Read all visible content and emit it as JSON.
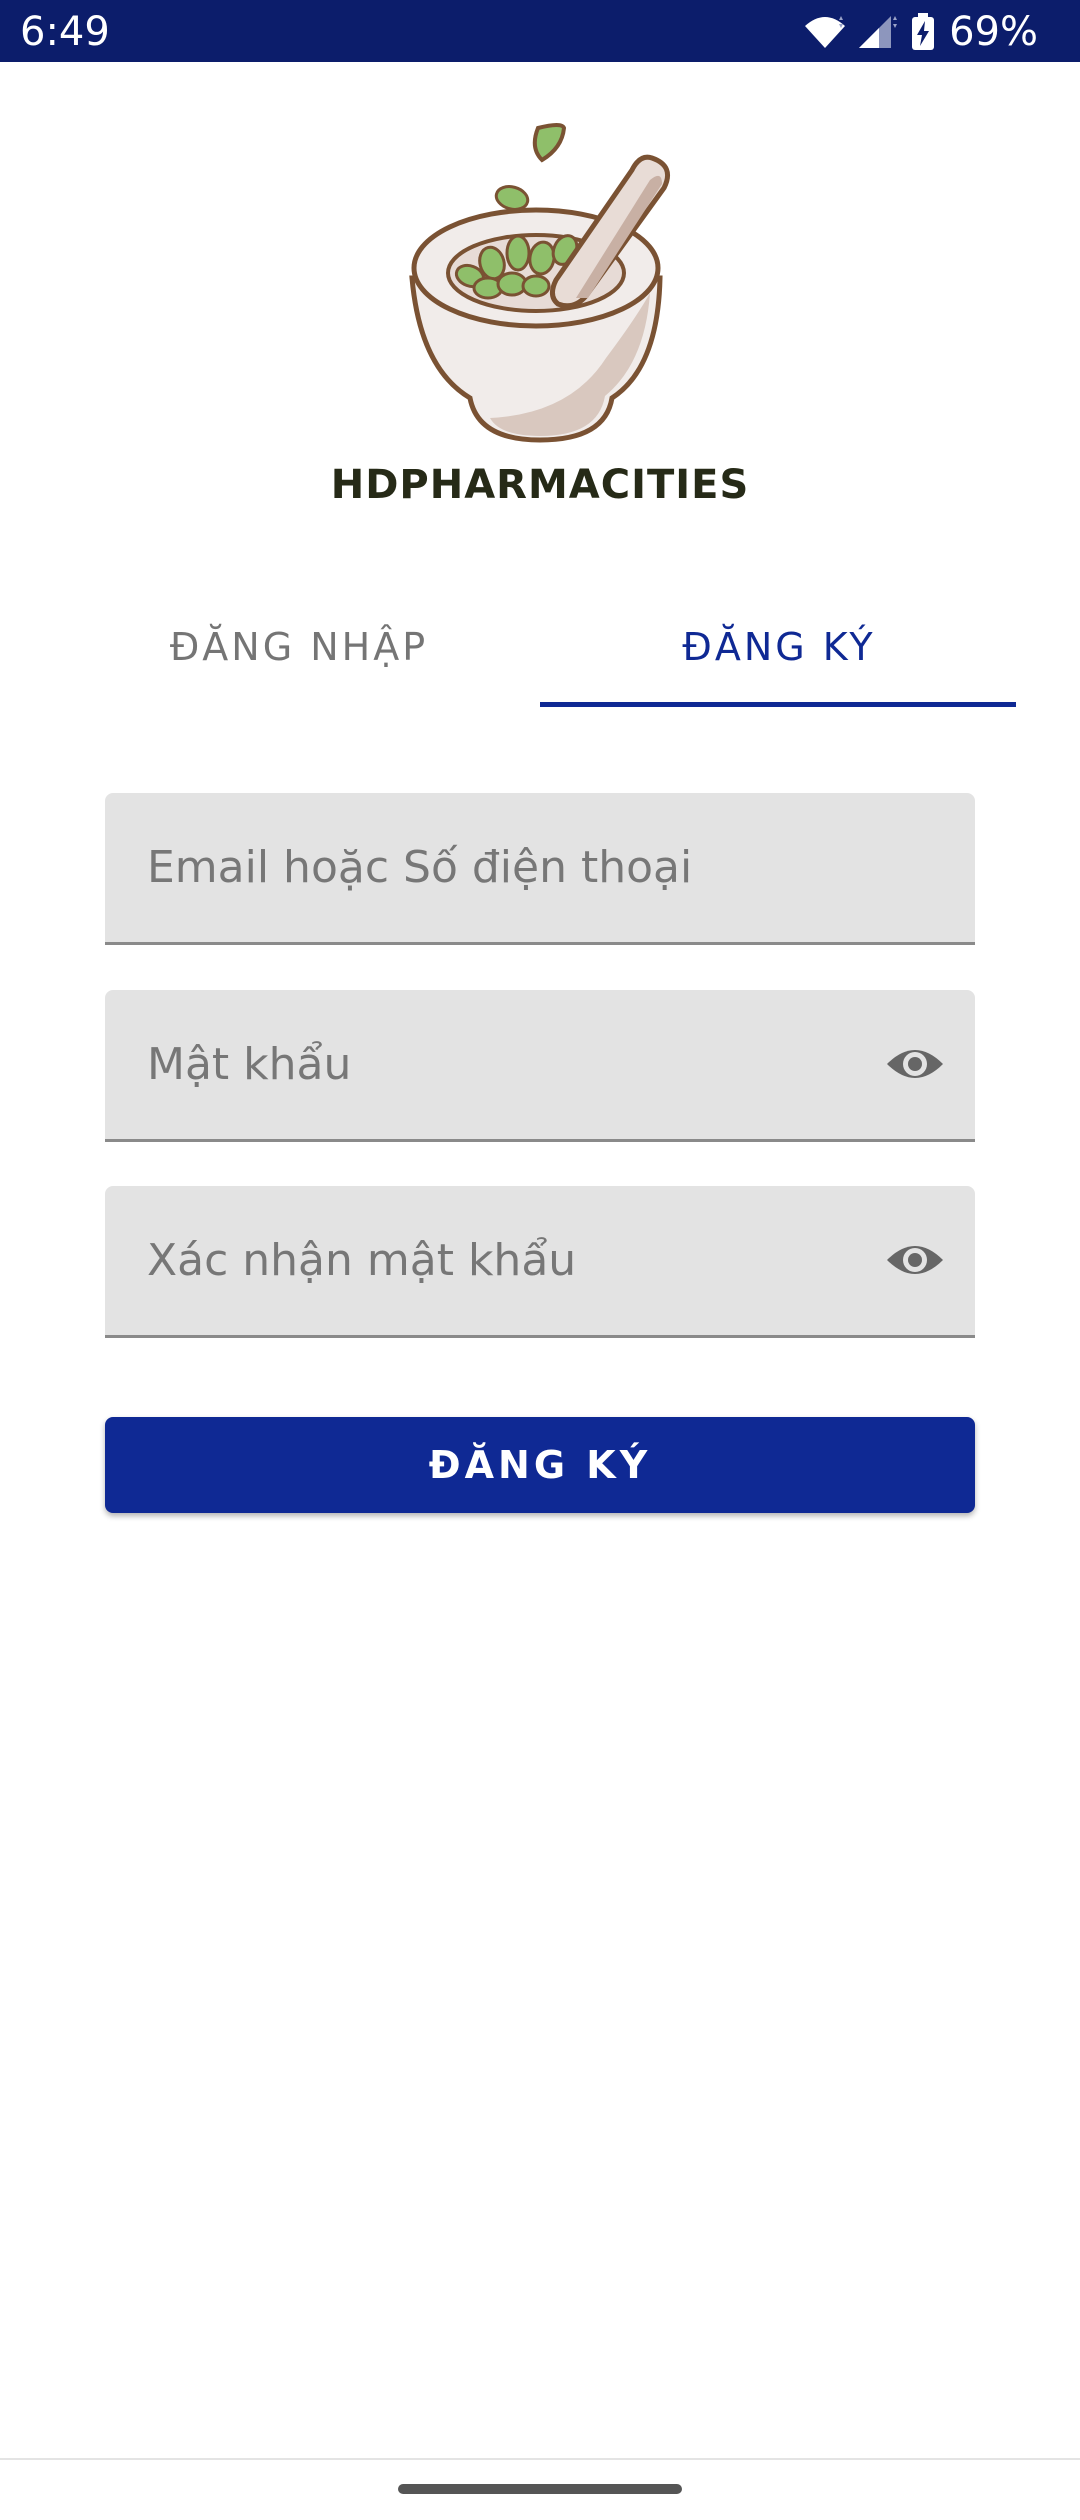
{
  "status_bar": {
    "time": "6:49",
    "battery": "69%",
    "background_color": "#0c1d6b"
  },
  "app": {
    "brand": "HDPHARMACITIES",
    "logo_icon": "mortar-pestle-herbs-logo"
  },
  "tabs": [
    {
      "label": "ĐĂNG NHẬP",
      "selected": false
    },
    {
      "label": "ĐĂNG KÝ",
      "selected": true
    }
  ],
  "form": {
    "email_placeholder": "Email hoặc Số điện thoại",
    "email_value": "",
    "password_placeholder": "Mật khẩu",
    "password_value": "",
    "confirm_placeholder": "Xác nhận mật khẩu",
    "confirm_value": "",
    "visibility_icon": "eye-icon"
  },
  "submit_label": "ĐĂNG KÝ",
  "colors": {
    "primary": "#0f2994",
    "field_background": "#e3e3e3",
    "inactive_tab": "#757575"
  }
}
